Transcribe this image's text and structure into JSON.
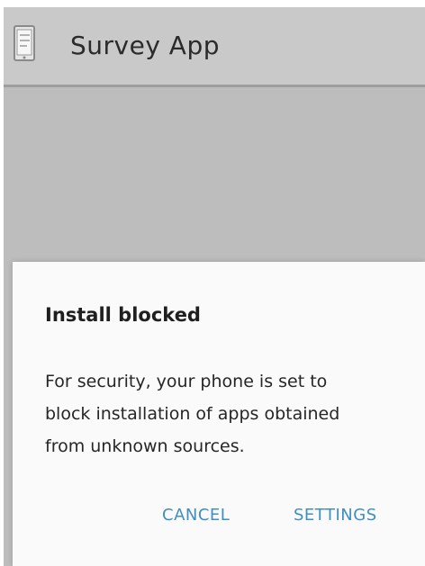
{
  "app": {
    "title": "Survey App",
    "icon": "survey-form-icon"
  },
  "dialog": {
    "title": "Install blocked",
    "message": "For security, your phone is set to\nblock installation of apps obtained\nfrom unknown sources.",
    "cancel_label": "CANCEL",
    "settings_label": "SETTINGS"
  },
  "colors": {
    "appbar": "#c9c9c9",
    "scrim": "#bdbdbd",
    "dialog_background": "#fafafa",
    "accent": "#3f8fc0"
  }
}
